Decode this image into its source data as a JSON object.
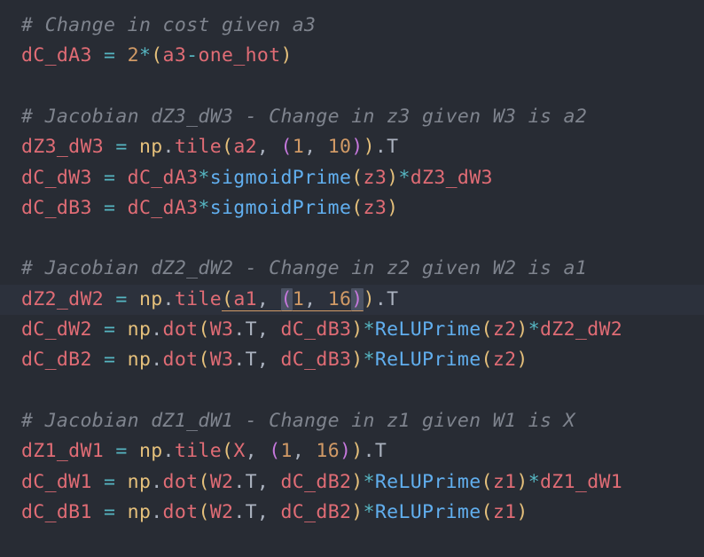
{
  "editor": {
    "lines": [
      {
        "type": "comment",
        "text": "# Change in cost given a3"
      },
      {
        "type": "code",
        "tokens": [
          {
            "t": "dC_dA3",
            "c": "tok-var"
          },
          {
            "t": " = ",
            "c": "tok-op"
          },
          {
            "t": "2",
            "c": "tok-num"
          },
          {
            "t": "*",
            "c": "tok-op"
          },
          {
            "t": "(",
            "c": "tok-paren1"
          },
          {
            "t": "a3",
            "c": "tok-var"
          },
          {
            "t": "-",
            "c": "tok-op"
          },
          {
            "t": "one_hot",
            "c": "tok-var"
          },
          {
            "t": ")",
            "c": "tok-paren1"
          }
        ]
      },
      {
        "type": "blank"
      },
      {
        "type": "comment",
        "text": "# Jacobian dZ3_dW3 - Change in z3 given W3 is a2"
      },
      {
        "type": "code",
        "tokens": [
          {
            "t": "dZ3_dW3",
            "c": "tok-var"
          },
          {
            "t": " = ",
            "c": "tok-op"
          },
          {
            "t": "np",
            "c": "tok-np"
          },
          {
            "t": ".",
            "c": "tok-plain"
          },
          {
            "t": "tile",
            "c": "tok-var"
          },
          {
            "t": "(",
            "c": "tok-paren1"
          },
          {
            "t": "a2",
            "c": "tok-var"
          },
          {
            "t": ", ",
            "c": "tok-plain"
          },
          {
            "t": "(",
            "c": "tok-paren2"
          },
          {
            "t": "1",
            "c": "tok-num"
          },
          {
            "t": ", ",
            "c": "tok-plain"
          },
          {
            "t": "10",
            "c": "tok-num"
          },
          {
            "t": ")",
            "c": "tok-paren2"
          },
          {
            "t": ")",
            "c": "tok-paren1"
          },
          {
            "t": ".T",
            "c": "tok-plain"
          }
        ]
      },
      {
        "type": "code",
        "tokens": [
          {
            "t": "dC_dW3",
            "c": "tok-var"
          },
          {
            "t": " = ",
            "c": "tok-op"
          },
          {
            "t": "dC_dA3",
            "c": "tok-var"
          },
          {
            "t": "*",
            "c": "tok-op"
          },
          {
            "t": "sigmoidPrime",
            "c": "tok-func"
          },
          {
            "t": "(",
            "c": "tok-paren1"
          },
          {
            "t": "z3",
            "c": "tok-var"
          },
          {
            "t": ")",
            "c": "tok-paren1"
          },
          {
            "t": "*",
            "c": "tok-op"
          },
          {
            "t": "dZ3_dW3",
            "c": "tok-var"
          }
        ]
      },
      {
        "type": "code",
        "tokens": [
          {
            "t": "dC_dB3",
            "c": "tok-var"
          },
          {
            "t": " = ",
            "c": "tok-op"
          },
          {
            "t": "dC_dA3",
            "c": "tok-var"
          },
          {
            "t": "*",
            "c": "tok-op"
          },
          {
            "t": "sigmoidPrime",
            "c": "tok-func"
          },
          {
            "t": "(",
            "c": "tok-paren1"
          },
          {
            "t": "z3",
            "c": "tok-var"
          },
          {
            "t": ")",
            "c": "tok-paren1"
          }
        ]
      },
      {
        "type": "blank"
      },
      {
        "type": "comment",
        "text": "# Jacobian dZ2_dW2 - Change in z2 given W2 is a1"
      },
      {
        "type": "code",
        "active": true,
        "tokens": [
          {
            "t": "dZ2_dW2",
            "c": "tok-var"
          },
          {
            "t": " = ",
            "c": "tok-op"
          },
          {
            "t": "np",
            "c": "tok-np"
          },
          {
            "t": ".",
            "c": "tok-plain"
          },
          {
            "t": "tile",
            "c": "tok-var"
          },
          {
            "t": "(",
            "c": "tok-paren1",
            "u": true
          },
          {
            "t": "a1",
            "c": "tok-var",
            "u": true
          },
          {
            "t": ", ",
            "c": "tok-plain",
            "u": true
          },
          {
            "t": "(",
            "c": "tok-paren2",
            "u": true,
            "m": true
          },
          {
            "t": "1",
            "c": "tok-num",
            "u": true
          },
          {
            "t": ", ",
            "c": "tok-plain",
            "u": true
          },
          {
            "t": "16",
            "c": "tok-num",
            "u": true
          },
          {
            "t": ")",
            "c": "tok-paren2",
            "u": true,
            "m": true
          },
          {
            "t": ")",
            "c": "tok-paren1"
          },
          {
            "t": ".T",
            "c": "tok-plain"
          }
        ]
      },
      {
        "type": "code",
        "tokens": [
          {
            "t": "dC_dW2",
            "c": "tok-var"
          },
          {
            "t": " = ",
            "c": "tok-op"
          },
          {
            "t": "np",
            "c": "tok-np"
          },
          {
            "t": ".",
            "c": "tok-plain"
          },
          {
            "t": "dot",
            "c": "tok-var"
          },
          {
            "t": "(",
            "c": "tok-paren1"
          },
          {
            "t": "W3",
            "c": "tok-var"
          },
          {
            "t": ".T, ",
            "c": "tok-plain"
          },
          {
            "t": "dC_dB3",
            "c": "tok-var"
          },
          {
            "t": ")",
            "c": "tok-paren1"
          },
          {
            "t": "*",
            "c": "tok-op"
          },
          {
            "t": "ReLUPrime",
            "c": "tok-func"
          },
          {
            "t": "(",
            "c": "tok-paren1"
          },
          {
            "t": "z2",
            "c": "tok-var"
          },
          {
            "t": ")",
            "c": "tok-paren1"
          },
          {
            "t": "*",
            "c": "tok-op"
          },
          {
            "t": "dZ2_dW2",
            "c": "tok-var"
          }
        ]
      },
      {
        "type": "code",
        "tokens": [
          {
            "t": "dC_dB2",
            "c": "tok-var"
          },
          {
            "t": " = ",
            "c": "tok-op"
          },
          {
            "t": "np",
            "c": "tok-np"
          },
          {
            "t": ".",
            "c": "tok-plain"
          },
          {
            "t": "dot",
            "c": "tok-var"
          },
          {
            "t": "(",
            "c": "tok-paren1"
          },
          {
            "t": "W3",
            "c": "tok-var"
          },
          {
            "t": ".T, ",
            "c": "tok-plain"
          },
          {
            "t": "dC_dB3",
            "c": "tok-var"
          },
          {
            "t": ")",
            "c": "tok-paren1"
          },
          {
            "t": "*",
            "c": "tok-op"
          },
          {
            "t": "ReLUPrime",
            "c": "tok-func"
          },
          {
            "t": "(",
            "c": "tok-paren1"
          },
          {
            "t": "z2",
            "c": "tok-var"
          },
          {
            "t": ")",
            "c": "tok-paren1"
          }
        ]
      },
      {
        "type": "blank"
      },
      {
        "type": "comment",
        "text": "# Jacobian dZ1_dW1 - Change in z1 given W1 is X"
      },
      {
        "type": "code",
        "tokens": [
          {
            "t": "dZ1_dW1",
            "c": "tok-var"
          },
          {
            "t": " = ",
            "c": "tok-op"
          },
          {
            "t": "np",
            "c": "tok-np"
          },
          {
            "t": ".",
            "c": "tok-plain"
          },
          {
            "t": "tile",
            "c": "tok-var"
          },
          {
            "t": "(",
            "c": "tok-paren1"
          },
          {
            "t": "X",
            "c": "tok-var"
          },
          {
            "t": ", ",
            "c": "tok-plain"
          },
          {
            "t": "(",
            "c": "tok-paren2"
          },
          {
            "t": "1",
            "c": "tok-num"
          },
          {
            "t": ", ",
            "c": "tok-plain"
          },
          {
            "t": "16",
            "c": "tok-num"
          },
          {
            "t": ")",
            "c": "tok-paren2"
          },
          {
            "t": ")",
            "c": "tok-paren1"
          },
          {
            "t": ".T",
            "c": "tok-plain"
          }
        ]
      },
      {
        "type": "code",
        "tokens": [
          {
            "t": "dC_dW1",
            "c": "tok-var"
          },
          {
            "t": " = ",
            "c": "tok-op"
          },
          {
            "t": "np",
            "c": "tok-np"
          },
          {
            "t": ".",
            "c": "tok-plain"
          },
          {
            "t": "dot",
            "c": "tok-var"
          },
          {
            "t": "(",
            "c": "tok-paren1"
          },
          {
            "t": "W2",
            "c": "tok-var"
          },
          {
            "t": ".T, ",
            "c": "tok-plain"
          },
          {
            "t": "dC_dB2",
            "c": "tok-var"
          },
          {
            "t": ")",
            "c": "tok-paren1"
          },
          {
            "t": "*",
            "c": "tok-op"
          },
          {
            "t": "ReLUPrime",
            "c": "tok-func"
          },
          {
            "t": "(",
            "c": "tok-paren1"
          },
          {
            "t": "z1",
            "c": "tok-var"
          },
          {
            "t": ")",
            "c": "tok-paren1"
          },
          {
            "t": "*",
            "c": "tok-op"
          },
          {
            "t": "dZ1_dW1",
            "c": "tok-var"
          }
        ]
      },
      {
        "type": "code",
        "tokens": [
          {
            "t": "dC_dB1",
            "c": "tok-var"
          },
          {
            "t": " = ",
            "c": "tok-op"
          },
          {
            "t": "np",
            "c": "tok-np"
          },
          {
            "t": ".",
            "c": "tok-plain"
          },
          {
            "t": "dot",
            "c": "tok-var"
          },
          {
            "t": "(",
            "c": "tok-paren1"
          },
          {
            "t": "W2",
            "c": "tok-var"
          },
          {
            "t": ".T, ",
            "c": "tok-plain"
          },
          {
            "t": "dC_dB2",
            "c": "tok-var"
          },
          {
            "t": ")",
            "c": "tok-paren1"
          },
          {
            "t": "*",
            "c": "tok-op"
          },
          {
            "t": "ReLUPrime",
            "c": "tok-func"
          },
          {
            "t": "(",
            "c": "tok-paren1"
          },
          {
            "t": "z1",
            "c": "tok-var"
          },
          {
            "t": ")",
            "c": "tok-paren1"
          }
        ]
      }
    ]
  }
}
